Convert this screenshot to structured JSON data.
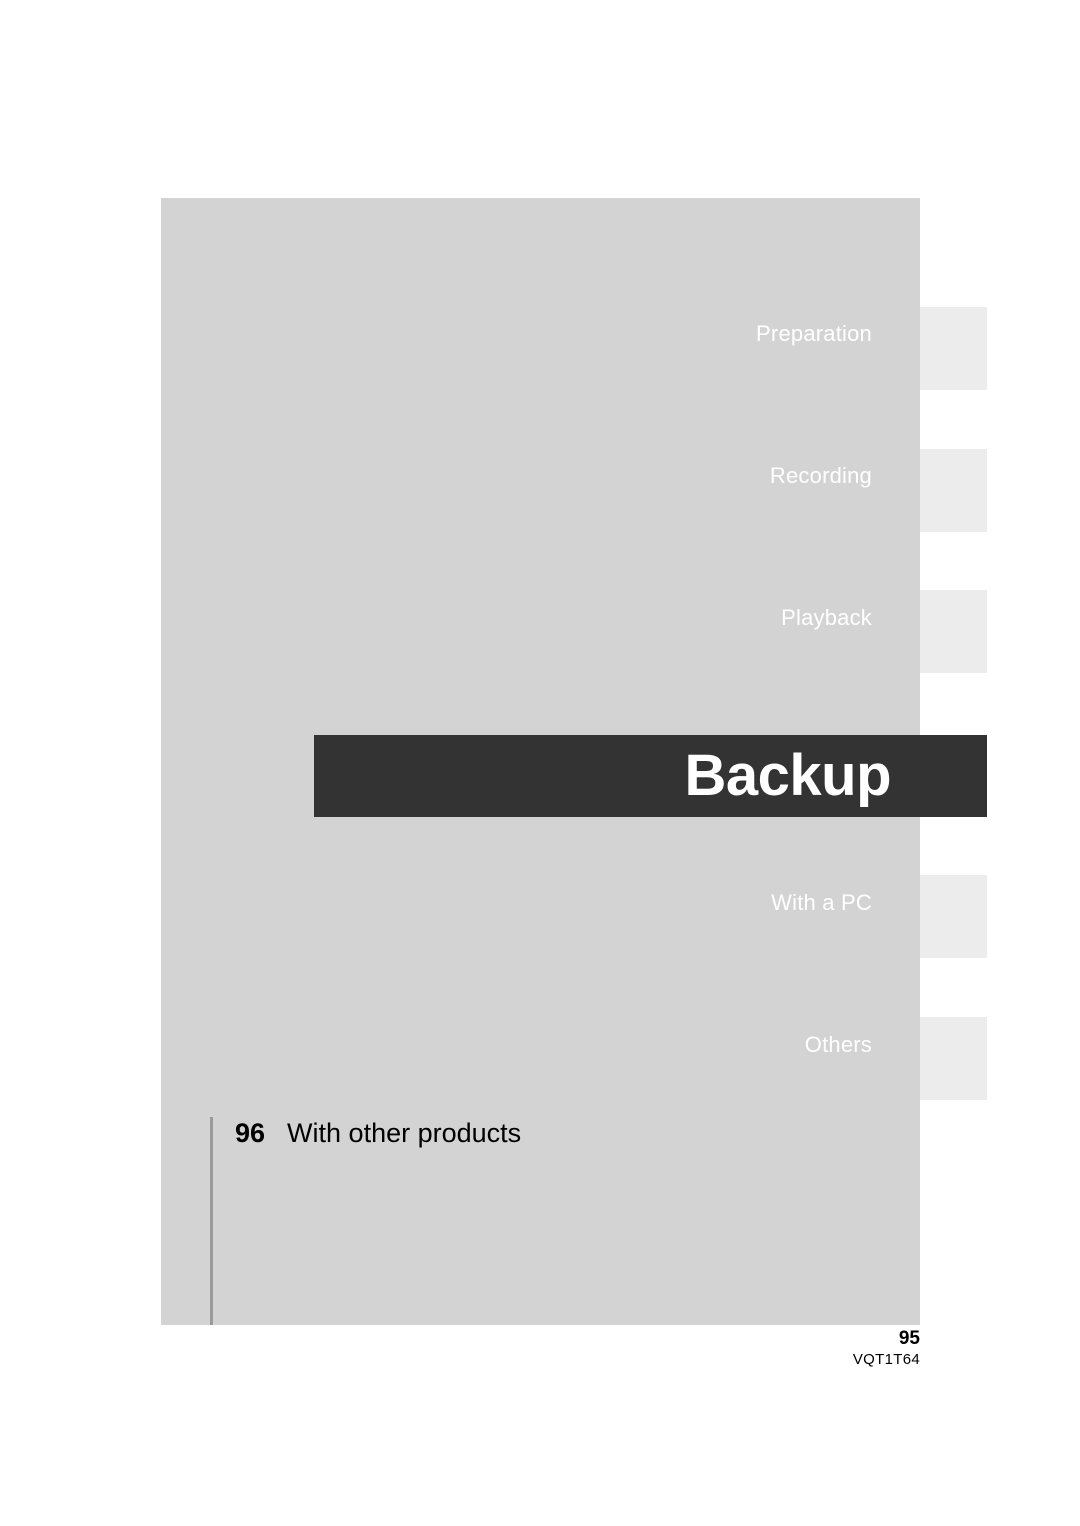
{
  "page": {
    "background_color": "#ffffff",
    "panel_color": "#d3d3d3",
    "tab_color": "#ececec",
    "banner_color": "#333333",
    "rule_color": "#9a9a9a"
  },
  "section_banner": {
    "title": "Backup"
  },
  "tabs": [
    {
      "label": "Preparation",
      "active": false
    },
    {
      "label": "Recording",
      "active": false
    },
    {
      "label": "Playback",
      "active": false
    },
    {
      "label": "Backup",
      "active": true
    },
    {
      "label": "With a PC",
      "active": false
    },
    {
      "label": "Others",
      "active": false
    }
  ],
  "contents": [
    {
      "page": "96",
      "title": "With other products"
    }
  ],
  "footer": {
    "page_number": "95",
    "document_code": "VQT1T64"
  }
}
